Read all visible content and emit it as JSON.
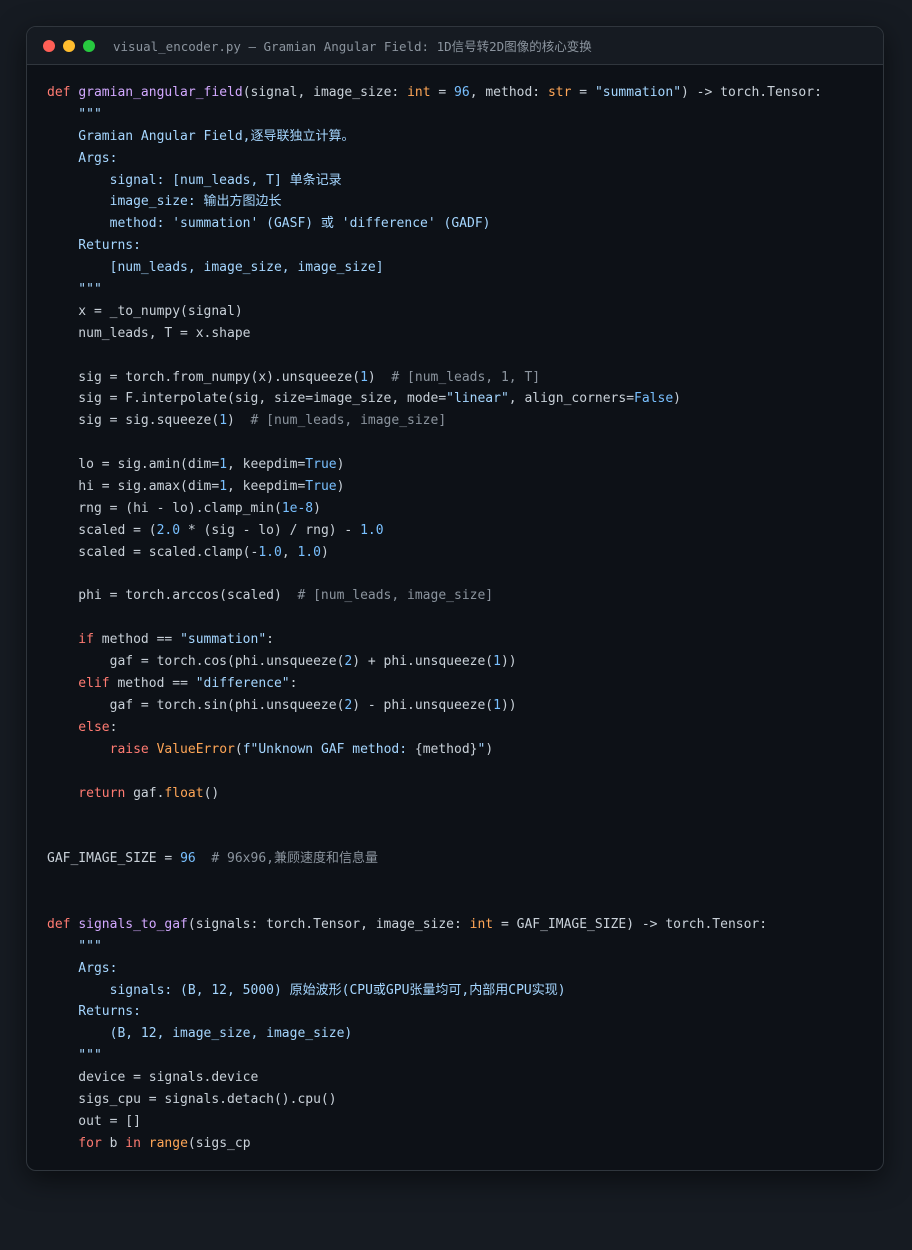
{
  "window": {
    "title": "visual_encoder.py — Gramian Angular Field: 1D信号转2D图像的核心变换"
  },
  "code_lines": [
    [
      [
        "kw",
        "def "
      ],
      [
        "fn",
        "gramian_angular_field"
      ],
      [
        "pl",
        "(signal, image_size: "
      ],
      [
        "bi",
        "int"
      ],
      [
        "pl",
        " = "
      ],
      [
        "num",
        "96"
      ],
      [
        "pl",
        ", method: "
      ],
      [
        "bi",
        "str"
      ],
      [
        "pl",
        " = "
      ],
      [
        "str",
        "\"summation\""
      ],
      [
        "pl",
        ") -> torch.Tensor:"
      ]
    ],
    [
      [
        "ds",
        "    \"\"\""
      ]
    ],
    [
      [
        "ds",
        "    Gramian Angular Field,逐导联独立计算。"
      ]
    ],
    [
      [
        "ds",
        "    Args:"
      ]
    ],
    [
      [
        "ds",
        "        signal: [num_leads, T] 单条记录"
      ]
    ],
    [
      [
        "ds",
        "        image_size: 输出方图边长"
      ]
    ],
    [
      [
        "ds",
        "        method: 'summation' (GASF) 或 'difference' (GADF)"
      ]
    ],
    [
      [
        "ds",
        "    Returns:"
      ]
    ],
    [
      [
        "ds",
        "        [num_leads, image_size, image_size]"
      ]
    ],
    [
      [
        "ds",
        "    \"\"\""
      ]
    ],
    [
      [
        "pl",
        "    x = _to_numpy(signal)"
      ]
    ],
    [
      [
        "pl",
        "    num_leads, T = x.shape"
      ]
    ],
    [],
    [
      [
        "pl",
        "    sig = torch.from_numpy(x).unsqueeze("
      ],
      [
        "num",
        "1"
      ],
      [
        "pl",
        ")  "
      ],
      [
        "cm",
        "# [num_leads, 1, T]"
      ]
    ],
    [
      [
        "pl",
        "    sig = F.interpolate(sig, size=image_size, mode="
      ],
      [
        "str",
        "\"linear\""
      ],
      [
        "pl",
        ", align_corners="
      ],
      [
        "num",
        "False"
      ],
      [
        "pl",
        ")"
      ]
    ],
    [
      [
        "pl",
        "    sig = sig.squeeze("
      ],
      [
        "num",
        "1"
      ],
      [
        "pl",
        ")  "
      ],
      [
        "cm",
        "# [num_leads, image_size]"
      ]
    ],
    [],
    [
      [
        "pl",
        "    lo = sig.amin(dim="
      ],
      [
        "num",
        "1"
      ],
      [
        "pl",
        ", keepdim="
      ],
      [
        "num",
        "True"
      ],
      [
        "pl",
        ")"
      ]
    ],
    [
      [
        "pl",
        "    hi = sig.amax(dim="
      ],
      [
        "num",
        "1"
      ],
      [
        "pl",
        ", keepdim="
      ],
      [
        "num",
        "True"
      ],
      [
        "pl",
        ")"
      ]
    ],
    [
      [
        "pl",
        "    rng = (hi - lo).clamp_min("
      ],
      [
        "num",
        "1e-8"
      ],
      [
        "pl",
        ")"
      ]
    ],
    [
      [
        "pl",
        "    scaled = ("
      ],
      [
        "num",
        "2.0"
      ],
      [
        "pl",
        " * (sig - lo) / rng) - "
      ],
      [
        "num",
        "1.0"
      ]
    ],
    [
      [
        "pl",
        "    scaled = scaled.clamp(-"
      ],
      [
        "num",
        "1.0"
      ],
      [
        "pl",
        ", "
      ],
      [
        "num",
        "1.0"
      ],
      [
        "pl",
        ")"
      ]
    ],
    [],
    [
      [
        "pl",
        "    phi = torch.arccos(scaled)  "
      ],
      [
        "cm",
        "# [num_leads, image_size]"
      ]
    ],
    [],
    [
      [
        "kw",
        "    if"
      ],
      [
        "pl",
        " method == "
      ],
      [
        "str",
        "\"summation\""
      ],
      [
        "pl",
        ":"
      ]
    ],
    [
      [
        "pl",
        "        gaf = torch.cos(phi.unsqueeze("
      ],
      [
        "num",
        "2"
      ],
      [
        "pl",
        ") + phi.unsqueeze("
      ],
      [
        "num",
        "1"
      ],
      [
        "pl",
        "))"
      ]
    ],
    [
      [
        "kw",
        "    elif"
      ],
      [
        "pl",
        " method == "
      ],
      [
        "str",
        "\"difference\""
      ],
      [
        "pl",
        ":"
      ]
    ],
    [
      [
        "pl",
        "        gaf = torch.sin(phi.unsqueeze("
      ],
      [
        "num",
        "2"
      ],
      [
        "pl",
        ") - phi.unsqueeze("
      ],
      [
        "num",
        "1"
      ],
      [
        "pl",
        "))"
      ]
    ],
    [
      [
        "kw",
        "    else"
      ],
      [
        "pl",
        ":"
      ]
    ],
    [
      [
        "kw",
        "        raise "
      ],
      [
        "bi",
        "ValueError"
      ],
      [
        "pl",
        "("
      ],
      [
        "str",
        "f\"Unknown GAF method: "
      ],
      [
        "pl",
        "{method}"
      ],
      [
        "str",
        "\""
      ],
      [
        "pl",
        ")"
      ]
    ],
    [],
    [
      [
        "kw",
        "    return"
      ],
      [
        "pl",
        " gaf."
      ],
      [
        "bi",
        "float"
      ],
      [
        "pl",
        "()"
      ]
    ],
    [],
    [],
    [
      [
        "pl",
        "GAF_IMAGE_SIZE = "
      ],
      [
        "num",
        "96"
      ],
      [
        "pl",
        "  "
      ],
      [
        "cm",
        "# 96x96,兼顾速度和信息量"
      ]
    ],
    [],
    [],
    [
      [
        "kw",
        "def "
      ],
      [
        "fn",
        "signals_to_gaf"
      ],
      [
        "pl",
        "(signals: torch.Tensor, image_size: "
      ],
      [
        "bi",
        "int"
      ],
      [
        "pl",
        " = GAF_IMAGE_SIZE) -> torch.Tensor:"
      ]
    ],
    [
      [
        "ds",
        "    \"\"\""
      ]
    ],
    [
      [
        "ds",
        "    Args:"
      ]
    ],
    [
      [
        "ds",
        "        signals: (B, 12, 5000) 原始波形(CPU或GPU张量均可,内部用CPU实现)"
      ]
    ],
    [
      [
        "ds",
        "    Returns:"
      ]
    ],
    [
      [
        "ds",
        "        (B, 12, image_size, image_size)"
      ]
    ],
    [
      [
        "ds",
        "    \"\"\""
      ]
    ],
    [
      [
        "pl",
        "    device = signals.device"
      ]
    ],
    [
      [
        "pl",
        "    sigs_cpu = signals.detach().cpu()"
      ]
    ],
    [
      [
        "pl",
        "    out = []"
      ]
    ],
    [
      [
        "kw",
        "    for"
      ],
      [
        "pl",
        " b "
      ],
      [
        "kw",
        "in "
      ],
      [
        "bi",
        "range"
      ],
      [
        "pl",
        "(sigs_cp"
      ]
    ]
  ]
}
